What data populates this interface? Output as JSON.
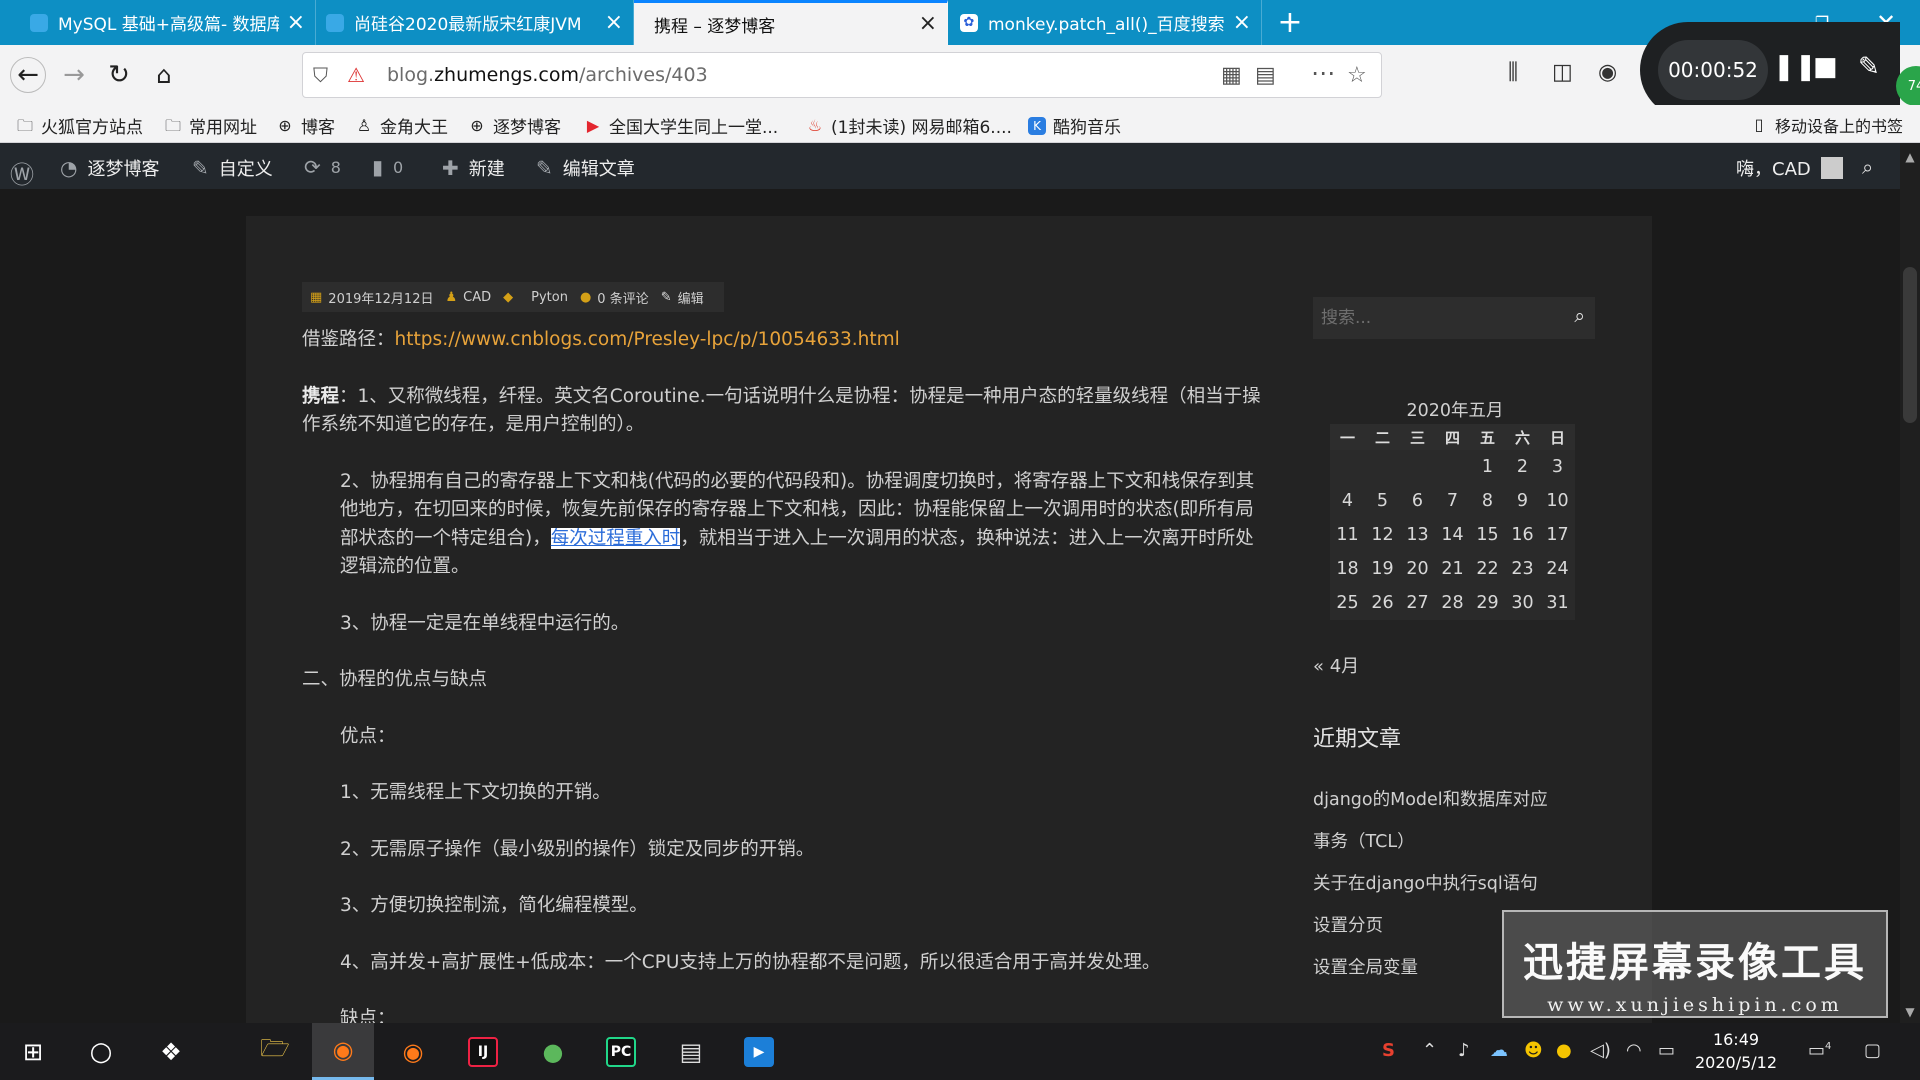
{
  "browser": {
    "tabs": [
      {
        "label": "MySQL 基础+高级篇- 数据库"
      },
      {
        "label": "尚硅谷2020最新版宋红康JVM"
      },
      {
        "label": "携程 – 逐梦博客"
      },
      {
        "label": "monkey.patch_all()_百度搜索"
      }
    ],
    "new_tab": "+",
    "url_prefix": "blog.",
    "url_domain": "zhumengs.com",
    "url_path": "/archives/403",
    "bookmarks": [
      "火狐官方站点",
      "常用网址",
      "博客",
      "金角大王",
      "逐梦博客",
      "全国大学生同上一堂...",
      "(1封未读) 网易邮箱6....",
      "酷狗音乐"
    ],
    "mobile_bookmarks": "移动设备上的书签"
  },
  "recorder": {
    "timer": "00:00:52",
    "badge": "74"
  },
  "wp_admin": {
    "site_name": "逐梦博客",
    "customize": "自定义",
    "updates": "8",
    "comments": "0",
    "new": "新建",
    "edit_post": "编辑文章",
    "greeting": "嗨，CAD"
  },
  "post": {
    "meta": {
      "date": "2019年12月12日",
      "author": "CAD",
      "tag": "Pyton",
      "comments": "0 条评论",
      "edit": "编辑"
    },
    "ref_label": "借鉴路径：",
    "ref_url": "https://www.cnblogs.com/Presley-lpc/p/10054633.html",
    "p1_bold": "携程",
    "p1": "：1、又称微线程，纤程。英文名Coroutine.一句话说明什么是协程：协程是一种用户态的轻量级线程（相当于操作系统不知道它的存在，是用户控制的）。",
    "p2_a": "2、协程拥有自己的寄存器上下文和栈(代码的必要的代码段和)。协程调度切换时，将寄存器上下文和栈保存到其他地方，在切回来的时候，恢复先前保存的寄存器上下文和栈，因此：协程能保留上一次调用时的状态(即所有局部状态的一个特定组合)，",
    "p2_highlight": "每次过程重入时",
    "p2_b": "，就相当于进入上一次调用的状态，换种说法：进入上一次离开时所处逻辑流的位置。",
    "p3": "3、协程一定是在单线程中运行的。",
    "h2": "二、协程的优点与缺点",
    "pros_label": "优点：",
    "pros": [
      "1、无需线程上下文切换的开销。",
      "2、无需原子操作（最小级别的操作）锁定及同步的开销。",
      "3、方便切换控制流，简化编程模型。",
      "4、高并发+高扩展性+低成本：一个CPU支持上万的协程都不是问题，所以很适合用于高并发处理。"
    ],
    "cons_label": "缺点："
  },
  "sidebar": {
    "search_placeholder": "搜索...",
    "calendar_caption": "2020年五月",
    "weekdays": [
      "一",
      "二",
      "三",
      "四",
      "五",
      "六",
      "日"
    ],
    "weeks": [
      [
        "",
        "",
        "",
        "",
        "1",
        "2",
        "3"
      ],
      [
        "4",
        "5",
        "6",
        "7",
        "8",
        "9",
        "10"
      ],
      [
        "11",
        "12",
        "13",
        "14",
        "15",
        "16",
        "17"
      ],
      [
        "18",
        "19",
        "20",
        "21",
        "22",
        "23",
        "24"
      ],
      [
        "25",
        "26",
        "27",
        "28",
        "29",
        "30",
        "31"
      ]
    ],
    "prev_month": "« 4月",
    "recent_title": "近期文章",
    "recent_posts": [
      "django的Model和数据库对应",
      "事务（TCL）",
      "关于在django中执行sql语句",
      "设置分页",
      "设置全局变量"
    ]
  },
  "watermark": {
    "title": "迅捷屏幕录像工具",
    "url": "www.xunjieshipin.com"
  },
  "taskbar": {
    "time": "16:49",
    "date": "2020/5/12",
    "notifications": "4"
  },
  "colors": {
    "tabbar": "#0d8fc4",
    "link": "#e8a33a",
    "meta_icon": "#d4a017",
    "wp_bar": "#23282d"
  }
}
